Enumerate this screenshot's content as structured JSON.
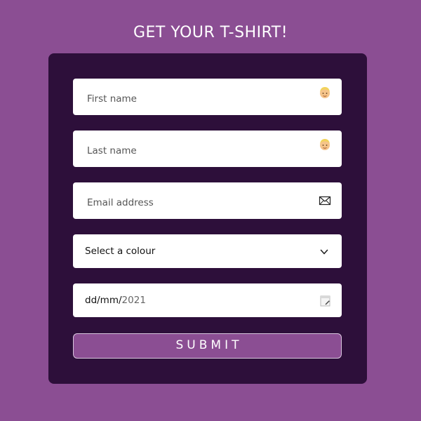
{
  "header": {
    "title": "GET YOUR T-SHIRT!"
  },
  "form": {
    "first_name": {
      "placeholder": "First name",
      "value": "",
      "icon": "person-emoji-icon"
    },
    "last_name": {
      "placeholder": "Last name",
      "value": "",
      "icon": "person-emoji-icon"
    },
    "email": {
      "placeholder": "Email address",
      "value": "",
      "icon": "envelope-icon"
    },
    "colour_select": {
      "selected_label": "Select a colour",
      "icon": "chevron-down-icon"
    },
    "date": {
      "day_month": "dd/mm/",
      "year": "2021",
      "icon": "calendar-icon"
    },
    "submit_label": "SUBMIT"
  },
  "colors": {
    "background": "#8b4e93",
    "card": "#2d0f3a",
    "field": "#ffffff",
    "button": "#8b4e93"
  }
}
